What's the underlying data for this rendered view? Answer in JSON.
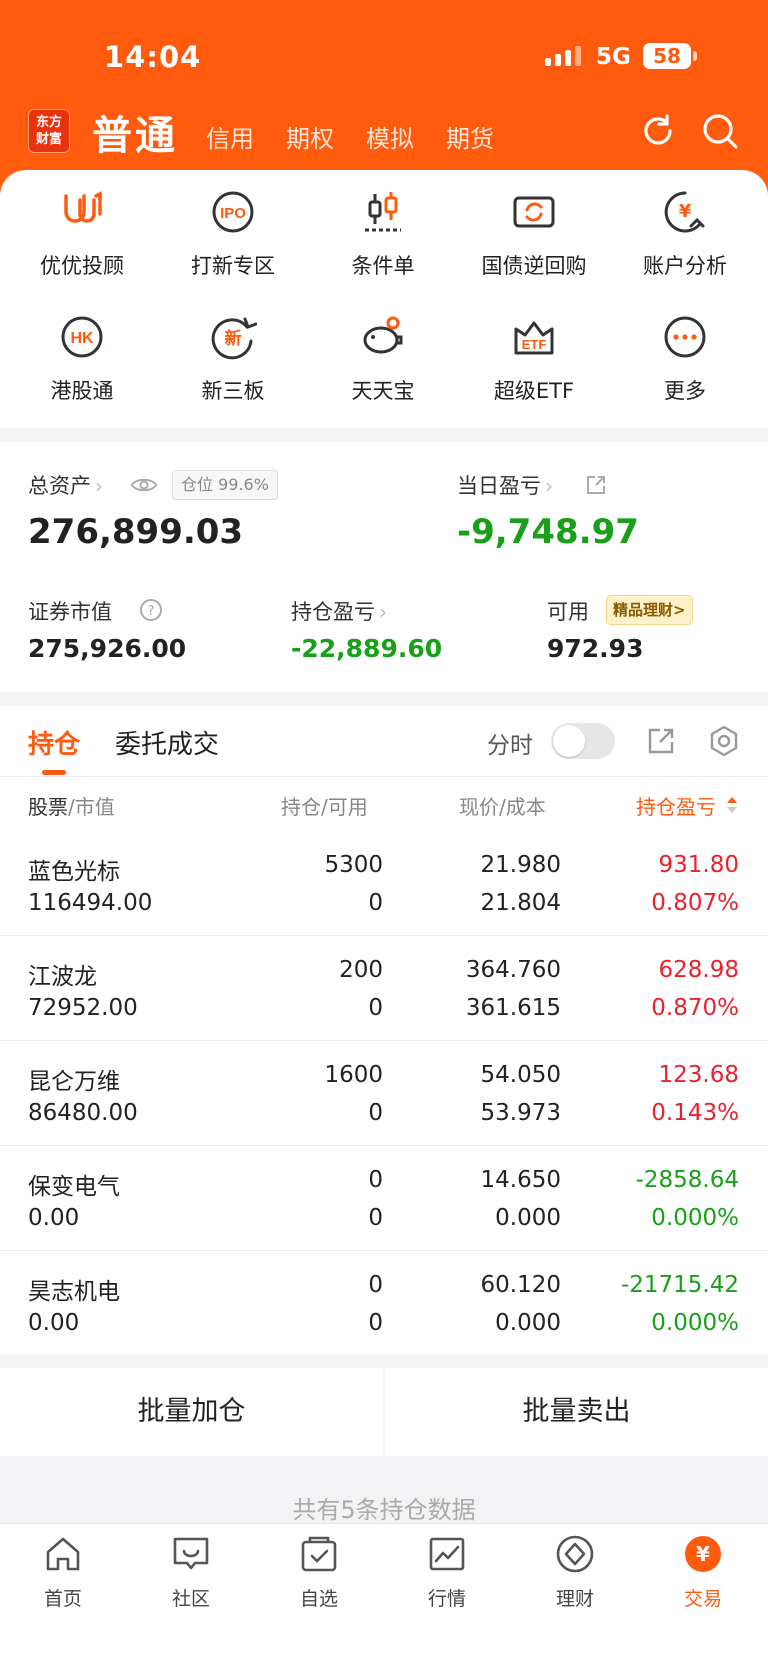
{
  "status_bar": {
    "time": "14:04",
    "network": "5G",
    "battery": "58"
  },
  "header": {
    "logo_line1": "东方",
    "logo_line2": "财富",
    "active_tab": "普通",
    "tabs": [
      "信用",
      "期权",
      "模拟",
      "期货"
    ]
  },
  "quick_actions": [
    {
      "label": "优优投顾",
      "icon": "uu-advisor-icon"
    },
    {
      "label": "打新专区",
      "icon": "ipo-icon"
    },
    {
      "label": "条件单",
      "icon": "candlestick-icon"
    },
    {
      "label": "国债逆回购",
      "icon": "repo-icon"
    },
    {
      "label": "账户分析",
      "icon": "account-analysis-icon"
    },
    {
      "label": "港股通",
      "icon": "hk-icon"
    },
    {
      "label": "新三板",
      "icon": "new-third-board-icon"
    },
    {
      "label": "天天宝",
      "icon": "piggy-bank-icon"
    },
    {
      "label": "超级ETF",
      "icon": "etf-icon"
    },
    {
      "label": "更多",
      "icon": "more-icon"
    }
  ],
  "assets": {
    "total_label": "总资产",
    "position_ratio": "仓位 99.6%",
    "total_value": "276,899.03",
    "daily_pl_label": "当日盈亏",
    "daily_pl_value": "-9,748.97",
    "market_value_label": "证券市值",
    "market_value": "275,926.00",
    "holding_pl_label": "持仓盈亏",
    "holding_pl_value": "-22,889.60",
    "available_label": "可用",
    "wealth_badge": "精品理财>",
    "available_value": "972.93"
  },
  "holdings": {
    "tab_active": "持仓",
    "tab_other": "委托成交",
    "fenshi_label": "分时",
    "columns": {
      "stock": "股票",
      "market_value": "市值",
      "position": "持仓",
      "available": "可用",
      "price": "现价",
      "cost": "成本",
      "pl": "持仓盈亏"
    },
    "rows": [
      {
        "name": "蓝色光标",
        "mv": "116494.00",
        "pos": "5300",
        "avail": "0",
        "price": "21.980",
        "cost": "21.804",
        "pl": "931.80",
        "pct": "0.807%",
        "color": "#e8222d"
      },
      {
        "name": "江波龙",
        "mv": "72952.00",
        "pos": "200",
        "avail": "0",
        "price": "364.760",
        "cost": "361.615",
        "pl": "628.98",
        "pct": "0.870%",
        "color": "#e8222d"
      },
      {
        "name": "昆仑万维",
        "mv": "86480.00",
        "pos": "1600",
        "avail": "0",
        "price": "54.050",
        "cost": "53.973",
        "pl": "123.68",
        "pct": "0.143%",
        "color": "#e8222d"
      },
      {
        "name": "保变电气",
        "mv": "0.00",
        "pos": "0",
        "avail": "0",
        "price": "14.650",
        "cost": "0.000",
        "pl": "-2858.64",
        "pct": "0.000%",
        "color": "#18a018"
      },
      {
        "name": "昊志机电",
        "mv": "0.00",
        "pos": "0",
        "avail": "0",
        "price": "60.120",
        "cost": "0.000",
        "pl": "-21715.42",
        "pct": "0.000%",
        "color": "#18a018"
      }
    ]
  },
  "batch": {
    "add": "批量加仓",
    "sell": "批量卖出"
  },
  "footer_note": "共有5条持仓数据",
  "tabbar": [
    {
      "label": "首页",
      "icon": "home-icon"
    },
    {
      "label": "社区",
      "icon": "community-icon"
    },
    {
      "label": "自选",
      "icon": "watchlist-icon"
    },
    {
      "label": "行情",
      "icon": "market-icon"
    },
    {
      "label": "理财",
      "icon": "wealth-icon"
    },
    {
      "label": "交易",
      "icon": "trade-icon"
    }
  ],
  "colors": {
    "brand": "#ff5a0e",
    "up": "#e8222d",
    "down": "#18a018"
  }
}
